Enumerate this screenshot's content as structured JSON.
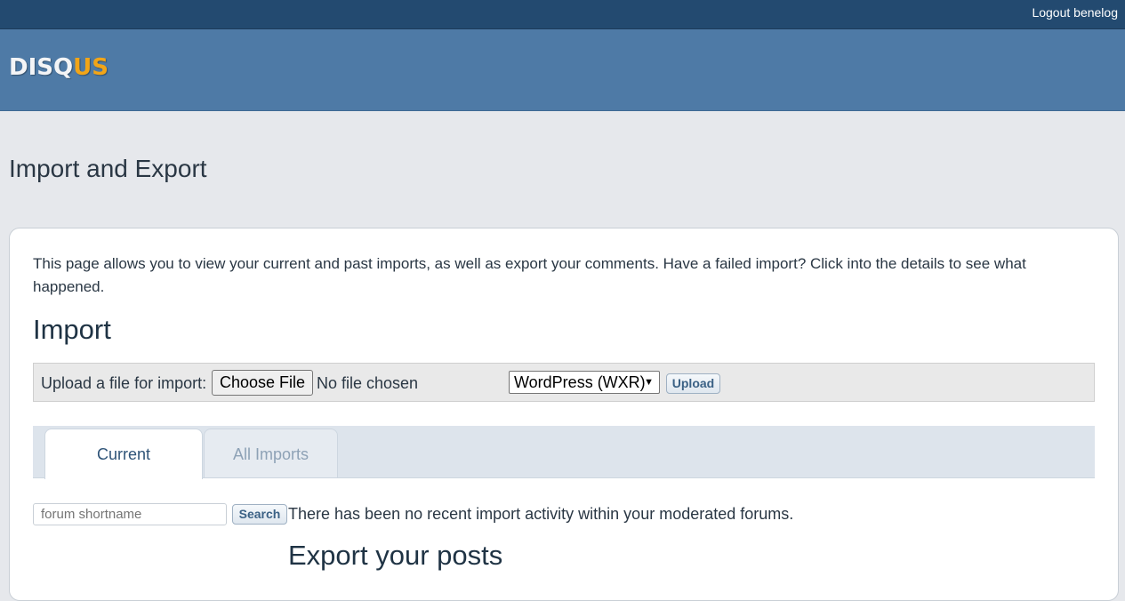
{
  "topbar": {
    "logout_label": "Logout benelog"
  },
  "header": {
    "logo_part1": "DISQ",
    "logo_part2": "US"
  },
  "page": {
    "title": "Import and Export"
  },
  "card": {
    "intro": "This page allows you to view your current and past imports, as well as export your comments. Have a failed import? Click into the details to see what happened.",
    "import_heading": "Import",
    "upload": {
      "label": "Upload a file for import:",
      "choose_file_label": "Choose File",
      "no_file_text": "No file chosen",
      "format_selected": "WordPress (WXR)",
      "upload_label": "Upload"
    },
    "tabs": [
      {
        "label": "Current",
        "active": true
      },
      {
        "label": "All Imports",
        "active": false
      }
    ],
    "search": {
      "placeholder": "forum shortname",
      "button_label": "Search"
    },
    "no_activity_text": "There has been no recent import activity within your moderated forums.",
    "export_heading": "Export your posts"
  },
  "colors": {
    "topbar": "#234a70",
    "header": "#4e7aa6",
    "logo_accent": "#f2a518",
    "background": "#e6e8ec"
  }
}
